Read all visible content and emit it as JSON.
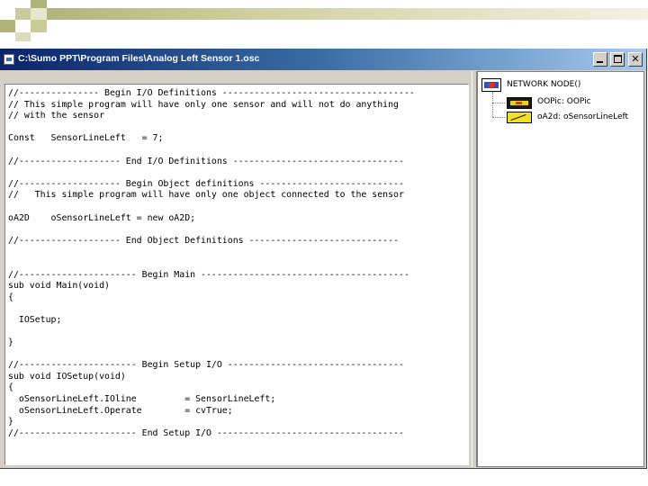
{
  "window": {
    "title": "C:\\Sumo PPT\\Program Files\\Analog Left Sensor 1.osc"
  },
  "editor": {
    "lines": [
      "//--------------- Begin I/O Definitions ------------------------------------",
      "// This simple program will have only one sensor and will not do anything",
      "// with the sensor",
      "",
      "Const   SensorLineLeft   = 7;",
      "",
      "//------------------- End I/O Definitions --------------------------------",
      "",
      "//------------------- Begin Object definitions ---------------------------",
      "//   This simple program will have only one object connected to the sensor",
      "",
      "oA2D    oSensorLineLeft = new oA2D;",
      "",
      "//------------------- End Object Definitions ----------------------------",
      "",
      "",
      "//---------------------- Begin Main ---------------------------------------",
      "sub void Main(void)",
      "{",
      "",
      "  IOSetup;",
      "",
      "}",
      "",
      "//---------------------- Begin Setup I/O ---------------------------------",
      "sub void IOSetup(void)",
      "{",
      "  oSensorLineLeft.IOline         = SensorLineLeft;",
      "  oSensorLineLeft.Operate        = cvTrue;",
      "}",
      "//---------------------- End Setup I/O -----------------------------------"
    ]
  },
  "tree": {
    "root_label": "NETWORK NODE()",
    "children": [
      {
        "label": "OOPic: OOPic"
      },
      {
        "label": "oA2d: oSensorLineLeft"
      }
    ]
  },
  "colors": {
    "titlebar_start": "#0a246a",
    "titlebar_end": "#a6caf0",
    "chrome": "#d4d0c8",
    "deco_square": "#b0b37a"
  }
}
